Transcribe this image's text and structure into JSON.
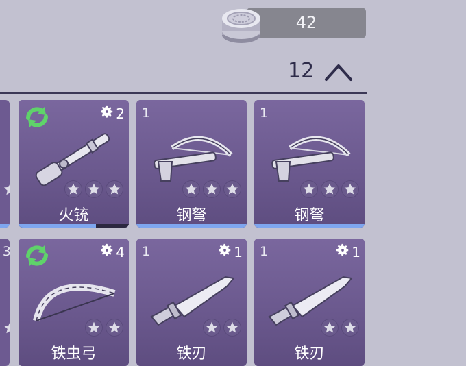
{
  "currency": {
    "value": "42",
    "icon": "silver-coin-icon"
  },
  "inventory": {
    "count": "12",
    "collapse_icon": "chevron-up-icon"
  },
  "partial_cards": [
    {
      "count": "",
      "stars": 3
    },
    {
      "count": "3",
      "stars": 2
    }
  ],
  "cards": [
    {
      "name": "火铳",
      "count": "",
      "gear": "2",
      "refresh": true,
      "stars": 3,
      "icon": "musket-icon",
      "progress": 0.7
    },
    {
      "name": "钢弩",
      "count": "1",
      "gear": "",
      "refresh": false,
      "stars": 3,
      "icon": "crossbow-icon",
      "progress": 1.0
    },
    {
      "name": "钢弩",
      "count": "1",
      "gear": "",
      "refresh": false,
      "stars": 3,
      "icon": "crossbow-icon",
      "progress": 1.0
    },
    {
      "name": "铁虫弓",
      "count": "",
      "gear": "4",
      "refresh": true,
      "stars": 2,
      "icon": "bow-icon",
      "progress": 0.0
    },
    {
      "name": "铁刃",
      "count": "1",
      "gear": "1",
      "refresh": false,
      "stars": 2,
      "icon": "blade-icon",
      "progress": 0.0
    },
    {
      "name": "铁刃",
      "count": "1",
      "gear": "1",
      "refresh": false,
      "stars": 2,
      "icon": "blade-icon",
      "progress": 0.0
    }
  ],
  "colors": {
    "background": "#c2c1d0",
    "card": "#6d5a91",
    "progress": "#7ea6ef",
    "refresh": "#5fd36a"
  }
}
